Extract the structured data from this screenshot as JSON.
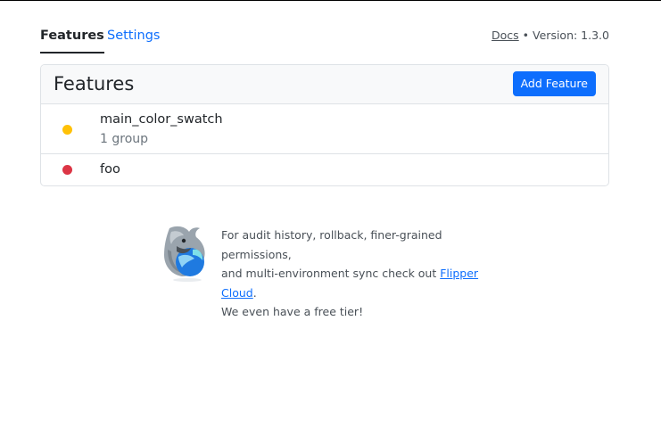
{
  "nav": {
    "tabs": [
      {
        "label": "Features",
        "active": true
      },
      {
        "label": "Settings",
        "active": false
      }
    ],
    "docs_label": "Docs",
    "separator": " • ",
    "version_text": "Version: 1.3.0"
  },
  "card": {
    "title": "Features",
    "add_button_label": "Add Feature",
    "features": [
      {
        "name": "main_color_swatch",
        "subtitle": "1 group",
        "status_color": "#ffc107"
      },
      {
        "name": "foo",
        "subtitle": "",
        "status_color": "#dc3545"
      }
    ]
  },
  "promo": {
    "mascot_icon": "flipper-dolphin-icon",
    "line_1": "For audit history, rollback, finer-grained permissions,",
    "line_2_prefix": "and multi-environment sync check out ",
    "link_label": "Flipper Cloud",
    "line_2_suffix": ".",
    "line_3": "We even have a free tier!"
  },
  "colors": {
    "primary": "#0d6efd",
    "header_bg": "#f8f9fa",
    "border": "#dee2e6",
    "text": "#212529",
    "muted": "#6c757d"
  }
}
